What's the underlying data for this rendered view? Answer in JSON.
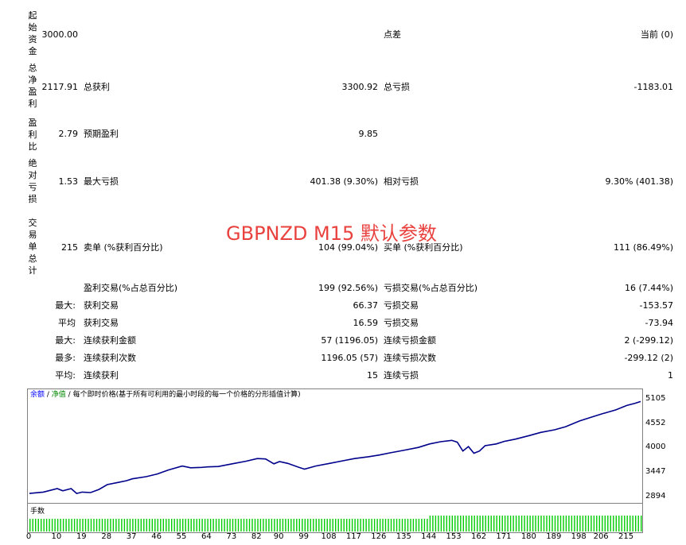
{
  "report": {
    "row1": {
      "vlabel": "起始资金",
      "value": "3000.00",
      "mid_label": "点差",
      "right_value": "当前 (0)"
    },
    "row2": {
      "vlabel": "总净盈利",
      "value": "2117.91",
      "label_a": "总获利",
      "value_a": "3300.92",
      "label_b": "总亏损",
      "value_b": "-1183.01"
    },
    "row3": {
      "vlabel": "盈利比",
      "value": "2.79",
      "label_a": "预期盈利",
      "value_a": "9.85"
    },
    "row4": {
      "vlabel": "绝对亏损",
      "value": "1.53",
      "label_a": "最大亏损",
      "value_a": "401.38 (9.30%)",
      "label_b": "相对亏损",
      "value_b": "9.30% (401.38)"
    },
    "row5": {
      "vlabel": "交易单总计",
      "value": "215",
      "label_a": "卖单 (%获利百分比)",
      "value_a": "104 (99.04%)",
      "label_b": "买单 (%获利百分比)",
      "value_b": "111 (86.49%)"
    },
    "rows": [
      {
        "prefix": "",
        "label_a": "盈利交易(%占总百分比)",
        "value_a": "199 (92.56%)",
        "label_b": "亏损交易(%占总百分比)",
        "value_b": "16 (7.44%)"
      },
      {
        "prefix": "最大:",
        "label_a": "获利交易",
        "value_a": "66.37",
        "label_b": "亏损交易",
        "value_b": "-153.57"
      },
      {
        "prefix": "平均",
        "label_a": "获利交易",
        "value_a": "16.59",
        "label_b": "亏损交易",
        "value_b": "-73.94"
      },
      {
        "prefix": "最大:",
        "label_a": "连续获利金额",
        "value_a": "57 (1196.05)",
        "label_b": "连续亏损金额",
        "value_b": "2 (-299.12)"
      },
      {
        "prefix": "最多:",
        "label_a": "连续获利次数",
        "value_a": "1196.05 (57)",
        "label_b": "连续亏损次数",
        "value_b": "-299.12 (2)"
      },
      {
        "prefix": "平均:",
        "label_a": "连续获利",
        "value_a": "15",
        "label_b": "连续亏损",
        "value_b": "1"
      }
    ]
  },
  "watermark": "GBPNZD M15 默认参数",
  "chart_caption": {
    "part1": "余额",
    "sep1": " / ",
    "part2": "净值",
    "sep2": " / ",
    "part3": "每个即时价格(基于所有可利用的最小时段的每一个价格的分形插值计算)"
  },
  "volume_label": "手数",
  "colors": {
    "line": "#00008b",
    "volume": "#00cc00",
    "watermark": "#e8413e"
  },
  "chart_data": {
    "type": "line",
    "title": "",
    "xlabel": "",
    "ylabel": "",
    "x_ticks": [
      "0",
      "10",
      "19",
      "28",
      "37",
      "46",
      "55",
      "64",
      "73",
      "82",
      "90",
      "99",
      "108",
      "117",
      "126",
      "135",
      "144",
      "153",
      "162",
      "171",
      "180",
      "189",
      "198",
      "206",
      "215"
    ],
    "y_ticks": [
      "5105",
      "4552",
      "4000",
      "3447",
      "2894"
    ],
    "ylim": [
      2894,
      5105
    ],
    "xlim": [
      0,
      220
    ],
    "series": [
      {
        "values": [
          [
            0,
            3000
          ],
          [
            5,
            3030
          ],
          [
            10,
            3110
          ],
          [
            12,
            3060
          ],
          [
            15,
            3110
          ],
          [
            17,
            3000
          ],
          [
            19,
            3030
          ],
          [
            22,
            3020
          ],
          [
            25,
            3090
          ],
          [
            28,
            3200
          ],
          [
            32,
            3250
          ],
          [
            35,
            3290
          ],
          [
            37,
            3330
          ],
          [
            42,
            3380
          ],
          [
            46,
            3440
          ],
          [
            50,
            3530
          ],
          [
            55,
            3620
          ],
          [
            58,
            3580
          ],
          [
            62,
            3590
          ],
          [
            64,
            3600
          ],
          [
            68,
            3610
          ],
          [
            73,
            3670
          ],
          [
            78,
            3730
          ],
          [
            82,
            3790
          ],
          [
            85,
            3780
          ],
          [
            88,
            3670
          ],
          [
            90,
            3720
          ],
          [
            93,
            3680
          ],
          [
            97,
            3590
          ],
          [
            99,
            3550
          ],
          [
            103,
            3620
          ],
          [
            108,
            3680
          ],
          [
            113,
            3740
          ],
          [
            117,
            3790
          ],
          [
            122,
            3830
          ],
          [
            126,
            3870
          ],
          [
            130,
            3920
          ],
          [
            135,
            3980
          ],
          [
            140,
            4040
          ],
          [
            144,
            4120
          ],
          [
            148,
            4170
          ],
          [
            152,
            4200
          ],
          [
            154,
            4160
          ],
          [
            156,
            3960
          ],
          [
            158,
            4060
          ],
          [
            160,
            3910
          ],
          [
            162,
            3960
          ],
          [
            164,
            4080
          ],
          [
            168,
            4120
          ],
          [
            171,
            4180
          ],
          [
            175,
            4230
          ],
          [
            180,
            4310
          ],
          [
            184,
            4380
          ],
          [
            189,
            4440
          ],
          [
            193,
            4510
          ],
          [
            198,
            4640
          ],
          [
            202,
            4720
          ],
          [
            206,
            4800
          ],
          [
            211,
            4890
          ],
          [
            215,
            4990
          ],
          [
            218,
            5040
          ],
          [
            220,
            5080
          ]
        ]
      },
      {
        "name": "手数",
        "values": []
      }
    ],
    "legend": "none",
    "grid": false
  }
}
